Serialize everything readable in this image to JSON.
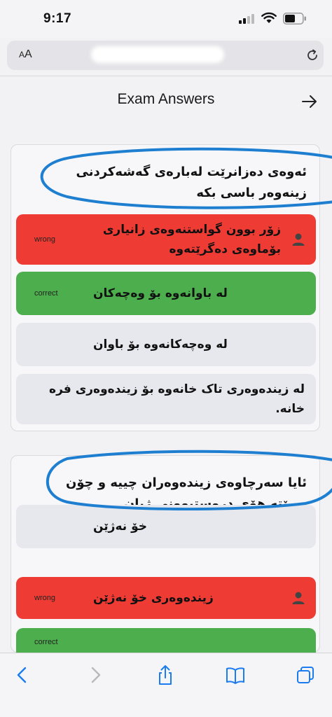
{
  "status_bar": {
    "time": "9:17"
  },
  "address_bar": {
    "text_size_label_small": "A",
    "text_size_label_large": "A"
  },
  "header": {
    "title": "Exam Answers"
  },
  "questions": [
    {
      "text": "ئەوەی دەزانرێت لەبارەی گەشەکردنی زینەوەر باسی بکە",
      "answers": [
        {
          "status": "wrong",
          "text": "زۆر بوون گواستنەوەی زانیاری بۆماوەی دەگرێتەوە"
        },
        {
          "status": "correct",
          "text": "لە باوانەوە بۆ وەچەکان"
        },
        {
          "status": "",
          "text": "لە وەچەکانەوە بۆ باوان"
        },
        {
          "status": "",
          "text": "لە زیندەوەری تاک خانەوە بۆ زیندەوەری فرە خانە."
        }
      ]
    },
    {
      "text": "ئایا سەرچاوەی زیندەوەران چییە و چۆن دەبێتە هۆی دروستبوونی ژیان",
      "answers": [
        {
          "status": "",
          "text": "خۆ نەژێن"
        },
        {
          "status": "wrong",
          "text": "زیندەوەری خۆ نەژێن"
        },
        {
          "status": "correct",
          "text": ""
        }
      ]
    }
  ],
  "colors": {
    "wrong": "#ee3b34",
    "correct": "#4cae4c",
    "neutral": "#e7e7ee",
    "annotation": "#1e7fd1"
  },
  "icons": [
    "signal-icon",
    "wifi-icon",
    "battery-icon",
    "reload-icon",
    "arrow-right-icon",
    "person-icon",
    "back-icon",
    "forward-icon",
    "share-icon",
    "bookmarks-icon",
    "tabs-icon"
  ]
}
